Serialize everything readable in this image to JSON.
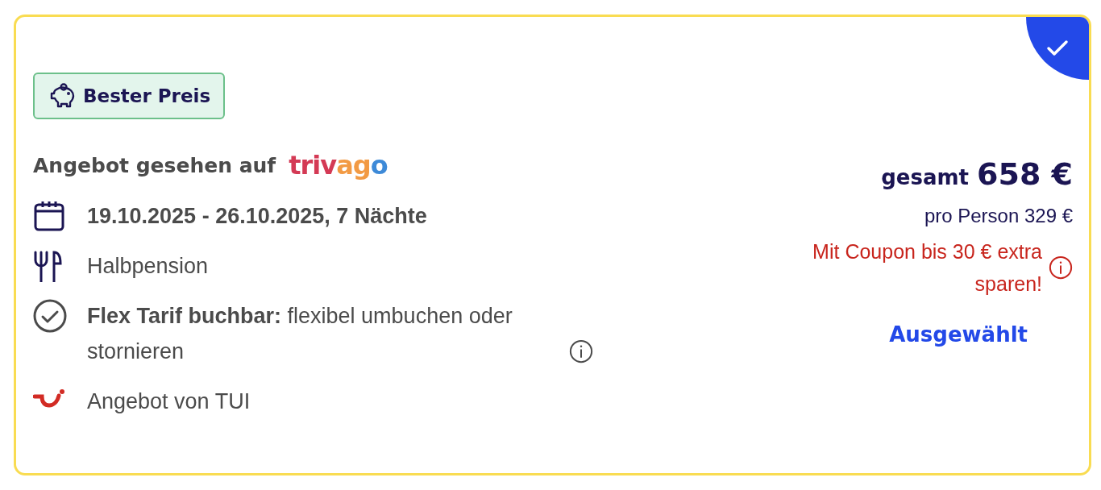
{
  "offer": {
    "selected": true,
    "badge": "Bester Preis",
    "seen_on": "Angebot gesehen auf",
    "seen_on_logo": "trivago",
    "features": [
      {
        "kind": "dates",
        "text": "19.10.2025 - 26.10.2025, 7 Nächte"
      },
      {
        "kind": "board",
        "text": "Halbpension"
      },
      {
        "kind": "flex",
        "text": "**Flex Tarif buchbar:** flexibel umbuchen oder stornieren",
        "info": true
      },
      {
        "kind": "operator",
        "text": "Angebot von TUI"
      }
    ],
    "total_label": "gesamt",
    "total_price": "658 €",
    "per_person": "pro Person 329 €",
    "coupon": "Mit Coupon bis 30 € extra sparen!",
    "action": "Ausgewählt"
  }
}
